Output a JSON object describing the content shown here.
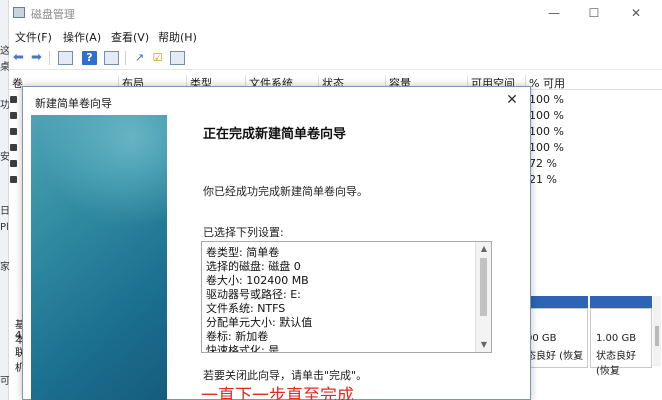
{
  "desktop": {
    "glyphs": [
      "这",
      "桌",
      "功",
      "安",
      "日",
      "Pl",
      "家",
      "基",
      "47",
      "联",
      "可"
    ]
  },
  "window": {
    "title": "磁盘管理",
    "controls": {
      "minimize": "—",
      "maximize": "☐",
      "close": "✕"
    }
  },
  "menu": [
    "文件(F)",
    "操作(A)",
    "查看(V)",
    "帮助(H)"
  ],
  "columns": [
    "卷",
    "布局",
    "类型",
    "文件系统",
    "状态",
    "容量",
    "可用空间",
    "% 可用"
  ],
  "volume_rows": [
    {
      "pct": "100 %"
    },
    {
      "pct": "100 %"
    },
    {
      "pct": "100 %"
    },
    {
      "pct": "100 %"
    },
    {
      "pct": "72 %"
    },
    {
      "pct": "21 %"
    }
  ],
  "disk_panel": {
    "left_labels": [
      "基本",
      "47",
      "联机"
    ],
    "segment_a": {
      "size": "00 GB",
      "status": "态良好 (恢复"
    },
    "segment_b": {
      "size": "1.00 GB",
      "status": "状态良好 (恢复"
    }
  },
  "dialog": {
    "title": "新建简单卷向导",
    "close": "✕",
    "heading": "正在完成新建简单卷向导",
    "intro": "你已经成功完成新建简单卷向导。",
    "settings_label": "已选择下列设置:",
    "settings": [
      "卷类型: 简单卷",
      "选择的磁盘: 磁盘 0",
      "卷大小: 102400 MB",
      "驱动器号或路径: E:",
      "文件系统: NTFS",
      "分配单元大小: 默认值",
      "卷标: 新加卷",
      "快速格式化: 是"
    ],
    "close_hint": "若要关闭此向导，请单击\"完成\"。",
    "annotation": "一直下一步直至完成"
  }
}
